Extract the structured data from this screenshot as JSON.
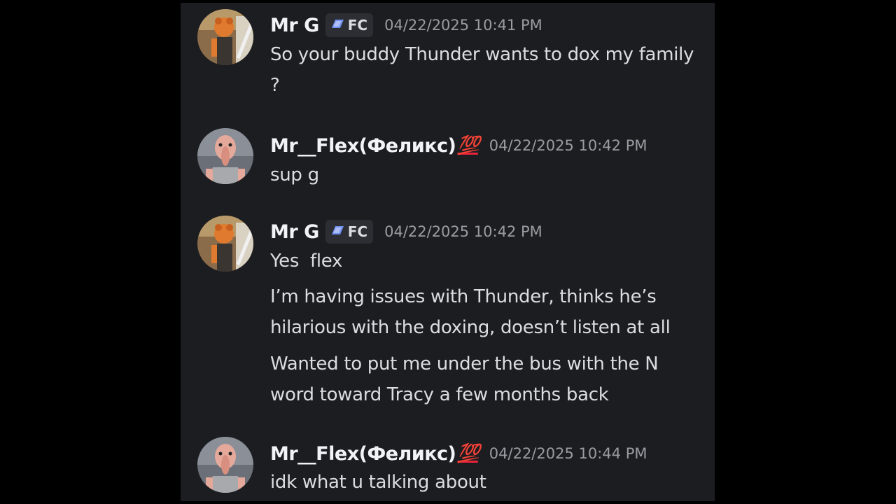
{
  "messages": [
    {
      "username": "Mr G",
      "tag": "FC",
      "timestamp": "04/22/2025 10:41 PM",
      "lines": [
        "So your buddy Thunder wants to dox my family ?"
      ]
    },
    {
      "username": "Mr__Flex(Феликс)",
      "emoji": "💯",
      "timestamp": "04/22/2025 10:42 PM",
      "lines": [
        "sup g"
      ]
    },
    {
      "username": "Mr G",
      "tag": "FC",
      "timestamp": "04/22/2025 10:42 PM",
      "lines": [
        "Yes  flex",
        "I’m having issues with Thunder, thinks he’s hilarious with the doxing, doesn’t listen at all",
        "Wanted to put me under the bus with the N word toward Tracy a few months back"
      ]
    },
    {
      "username": "Mr__Flex(Феликс)",
      "emoji": "💯",
      "timestamp": "04/22/2025 10:44 PM",
      "lines": [
        "idk what u talking about"
      ]
    }
  ],
  "colors": {
    "background": "#000000",
    "panel": "#1c1d21",
    "username": "#f2f3f5",
    "message_text": "#dcdde1",
    "timestamp": "#9b9ca3",
    "tag_background": "#2c2e34",
    "emoji_red": "#e8233a"
  },
  "icons": {
    "tag": "guild-tag-gem-icon",
    "emoji": "hundred-points-emoji"
  }
}
